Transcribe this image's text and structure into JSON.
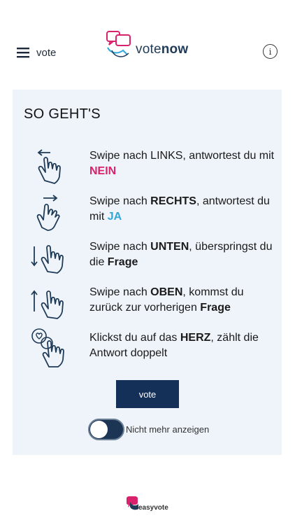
{
  "header": {
    "menu_label": "vote",
    "logo_text_a": "vote",
    "logo_text_b": "now",
    "info_label": "i"
  },
  "card": {
    "title": "SO GEHT'S",
    "instructions": [
      {
        "icon": "swipe-left-icon",
        "pre": "Swipe nach LINKS, antwortest du mit ",
        "accent": "NEIN"
      },
      {
        "icon": "swipe-right-icon",
        "pre": "Swipe nach ",
        "bold1": "RECHTS",
        "mid": ", antwortest du mit ",
        "accent": "JA"
      },
      {
        "icon": "swipe-down-icon",
        "pre": "Swipe nach ",
        "bold1": "UNTEN",
        "mid": ", überspringst du die ",
        "bold2": "Frage"
      },
      {
        "icon": "swipe-up-icon",
        "pre": "Swipe nach ",
        "bold1": "OBEN",
        "mid": ", kommst du zurück zur vorherigen ",
        "bold2": "Frage"
      },
      {
        "icon": "tap-heart-icon",
        "pre": "Klickst du auf das ",
        "bold1": "HERZ",
        "mid": ", zählt die Antwort doppelt"
      }
    ],
    "vote_button": "vote",
    "toggle_label": "Nicht mehr anzeigen"
  },
  "footer": {
    "brand": "easyvote"
  },
  "colors": {
    "accent_no": "#d8226b",
    "accent_yes": "#2fa8d8",
    "primary_dark": "#142f58",
    "card_bg": "#eff4fb"
  }
}
